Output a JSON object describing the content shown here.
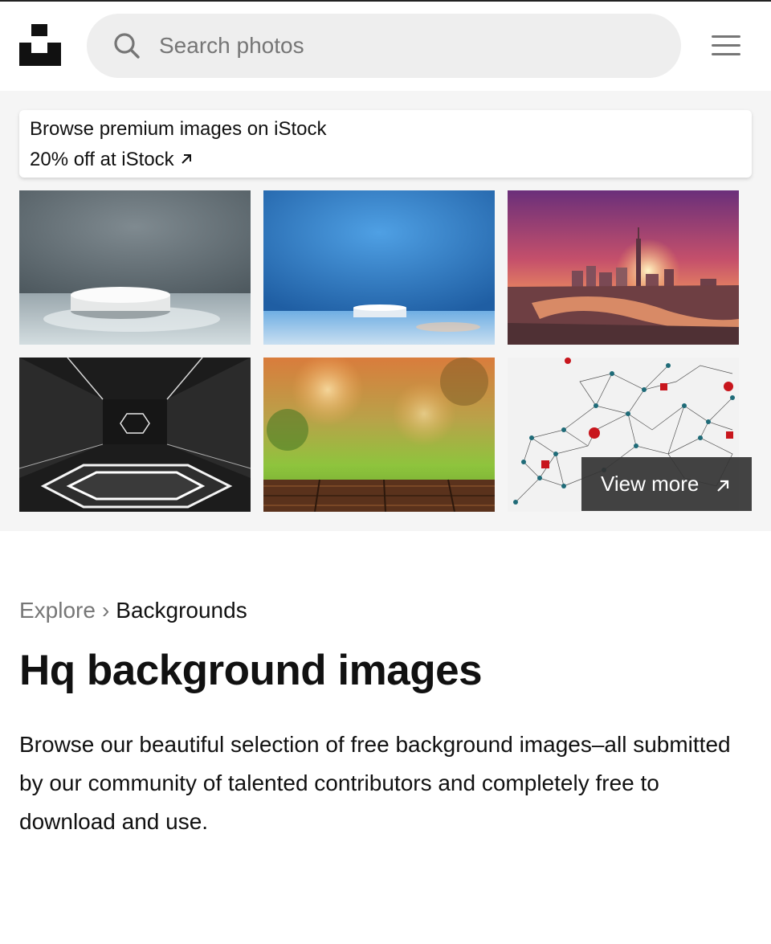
{
  "header": {
    "logo_icon": "unsplash-logo-icon",
    "search": {
      "placeholder": "Search photos",
      "value": "",
      "icon": "search-icon"
    },
    "menu_icon": "hamburger-menu-icon"
  },
  "promo": {
    "istock_title": "Browse premium images on iStock",
    "istock_offer": "20% off at iStock",
    "istock_offer_icon": "arrow-up-right-icon",
    "images": [
      {
        "name": "grey podium backdrop"
      },
      {
        "name": "blue podium backdrop"
      },
      {
        "name": "city sunset skyline"
      },
      {
        "name": "dark neon hexagon room"
      },
      {
        "name": "blurred forest with wooden table"
      },
      {
        "name": "network pins world map"
      }
    ],
    "view_more_label": "View more",
    "view_more_icon": "arrow-up-right-icon"
  },
  "breadcrumb": {
    "explore": "Explore",
    "separator": "›",
    "current": "Backgrounds"
  },
  "page": {
    "title": "Hq background images",
    "description": "Browse our beautiful selection of free background images–all submitted by our community of talented contributors and completely free to download and use."
  },
  "colors": {
    "promo_bg": "#f5f5f5",
    "muted_text": "#767676",
    "search_bg": "#eeeeee",
    "overlay_bg": "#333333"
  }
}
